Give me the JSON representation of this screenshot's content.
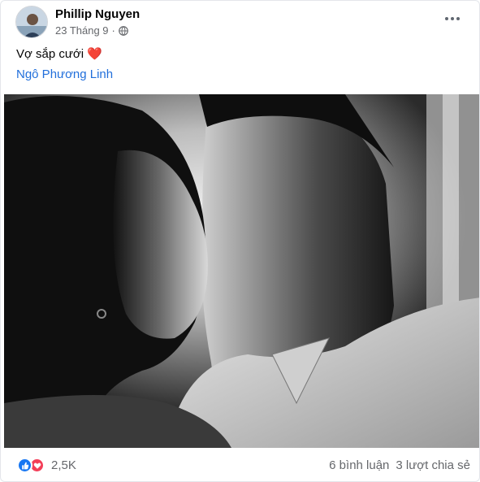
{
  "post": {
    "author": "Phillip Nguyen",
    "date": "23 Tháng 9",
    "separator": "·",
    "privacy_icon": "globe-icon",
    "more_icon": "more-options-icon",
    "text": "Vợ sắp cưới",
    "emoji": "❤️",
    "tagged_person": "Ngô Phương Linh"
  },
  "footer": {
    "reaction_icons": [
      "like-icon",
      "love-icon"
    ],
    "reaction_count": "2,5K",
    "comments": "6 bình luận",
    "shares": "3 lượt chia sẻ"
  },
  "colors": {
    "link": "#216fdb",
    "like": "#1877f2",
    "love": "#f33e58",
    "secondary_text": "#65676b"
  }
}
